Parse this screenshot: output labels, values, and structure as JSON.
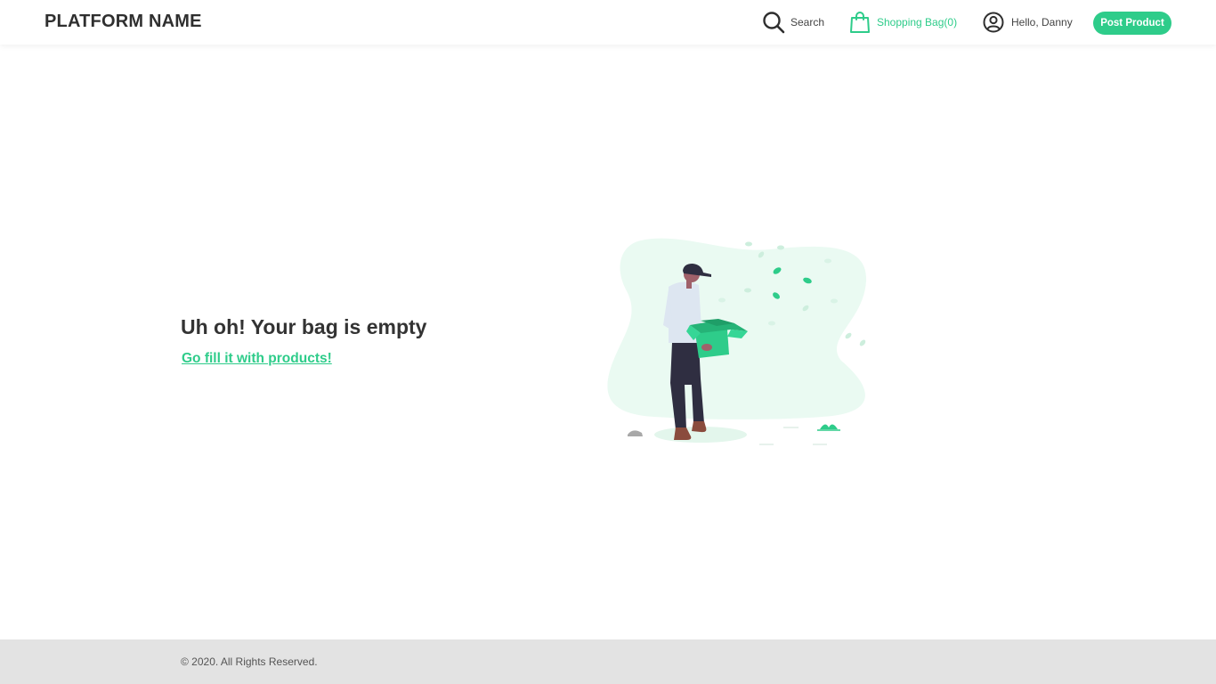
{
  "header": {
    "brand": "PLATFORM NAME",
    "nav": {
      "search_label": "Search",
      "search_icon": "search-icon",
      "bag_label": "Shopping Bag(0)",
      "bag_icon": "shopping-bag-icon",
      "user_label": "Hello, Danny",
      "user_icon": "user-circle-icon",
      "post_button": "Post Product"
    }
  },
  "main": {
    "title": "Uh oh! Your bag is empty",
    "link": "Go fill it with products!",
    "illustration": "empty-bag-illustration"
  },
  "footer": {
    "copyright": "© 2020. All Rights Reserved."
  },
  "colors": {
    "accent": "#2ecc8a",
    "footer_bg": "#e3e3e3",
    "text": "#333333"
  }
}
